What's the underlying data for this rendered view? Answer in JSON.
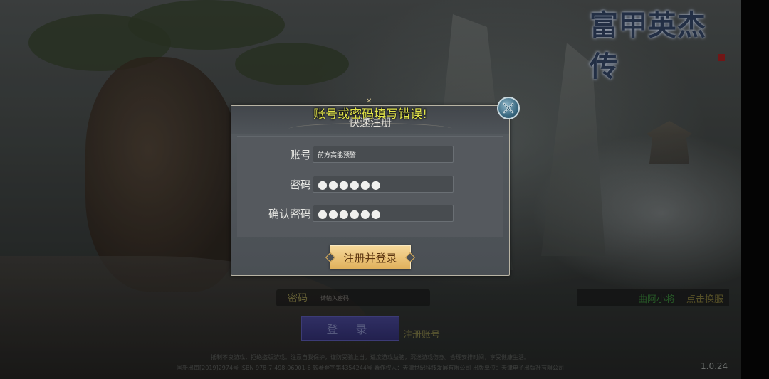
{
  "game": {
    "logo_text": "富甲英杰传",
    "version": "1.0.24"
  },
  "background_login": {
    "password_label": "密码",
    "password_placeholder": "请输入密码",
    "login_button": "登 录",
    "register_link": "注册账号",
    "server_name": "曲阿小将",
    "server_action": "点击换服"
  },
  "notices": {
    "health_notice": "抵制不良游戏，拒绝盗版游戏。注意自我保护，谨防受骗上当。适度游戏益脑，沉迷游戏伤身。合理安排时间，享受健康生活。",
    "license_info": "国新出审[2019]2974号 ISBN 978-7-498-06901-6 软著登字第4354244号 著作权人：天津世纪科技发展有限公司 出版单位：天津电子出版社有限公司"
  },
  "error_message": "账号或密码填写错误!",
  "register_dialog": {
    "title": "快速注册",
    "account_label": "账号",
    "account_value": "前方高能预警",
    "password_label": "密码",
    "password_value": "●●●●●●",
    "confirm_label": "确认密码",
    "confirm_value": "●●●●●●",
    "submit_button": "注册并登录",
    "close_icon": "close-icon"
  },
  "colors": {
    "error_text": "#e2e44a",
    "submit_button": "#e0b15c",
    "dialog_bg": "#4a4f54"
  }
}
